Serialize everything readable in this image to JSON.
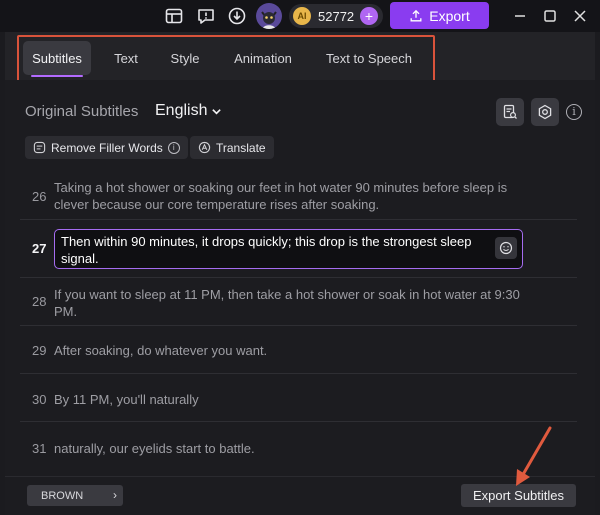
{
  "titlebar": {
    "credits": "52772",
    "coin_label": "AI",
    "plus_label": "+",
    "export_label": "Export"
  },
  "tabs": [
    {
      "label": "Subtitles",
      "active": true
    },
    {
      "label": "Text",
      "active": false
    },
    {
      "label": "Style",
      "active": false
    },
    {
      "label": "Animation",
      "active": false
    },
    {
      "label": "Text to Speech",
      "active": false
    }
  ],
  "header": {
    "title": "Original Subtitles",
    "language": "English",
    "language_chevron": "⌄"
  },
  "tools": {
    "remove_filler": "Remove Filler Words",
    "translate": "Translate"
  },
  "subtitles": [
    {
      "index": "26",
      "text": "Taking a hot shower or soaking our feet in hot water 90 minutes before sleep is clever because our core temperature rises after soaking."
    },
    {
      "index": "27",
      "text": "Then within 90 minutes, it drops quickly; this drop is the strongest sleep signal.",
      "active": true
    },
    {
      "index": "28",
      "text": "If you want to sleep at 11 PM, then take a hot shower or soak in hot water at 9:30 PM."
    },
    {
      "index": "29",
      "text": "After soaking, do whatever you want."
    },
    {
      "index": "30",
      "text": "By 11 PM, you'll naturally"
    },
    {
      "index": "31",
      "text": "naturally, our eyelids start to battle."
    }
  ],
  "footer": {
    "style_value": "BROWN",
    "style_chevron": "›",
    "export_subtitles": "Export Subtitles"
  },
  "colors": {
    "accent": "#8a3cf0",
    "highlight_box": "#d9533b",
    "annotation_arrow": "#e05a3e"
  },
  "icons": [
    "layout-icon",
    "feedback-icon",
    "download-icon",
    "avatar-icon",
    "coin-icon",
    "upload-icon",
    "minimize-icon",
    "maximize-icon",
    "close-icon",
    "subtitle-search-icon",
    "settings-icon",
    "info-icon",
    "emoji-icon"
  ]
}
